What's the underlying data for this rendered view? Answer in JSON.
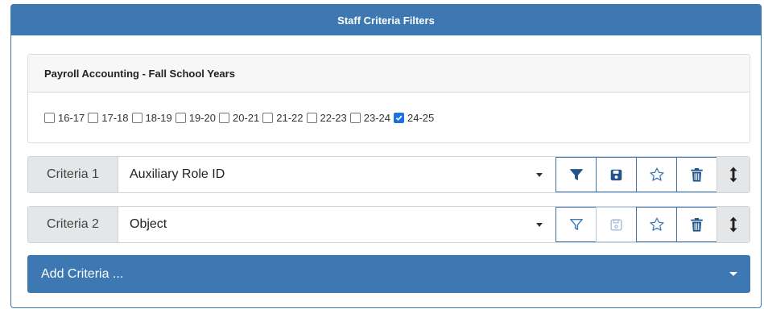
{
  "panel": {
    "title": "Staff Criteria Filters"
  },
  "group": {
    "title": "Payroll Accounting - Fall School Years",
    "years": [
      {
        "label": "16-17",
        "checked": false
      },
      {
        "label": "17-18",
        "checked": false
      },
      {
        "label": "18-19",
        "checked": false
      },
      {
        "label": "19-20",
        "checked": false
      },
      {
        "label": "20-21",
        "checked": false
      },
      {
        "label": "21-22",
        "checked": false
      },
      {
        "label": "22-23",
        "checked": false
      },
      {
        "label": "23-24",
        "checked": false
      },
      {
        "label": "24-25",
        "checked": true
      }
    ]
  },
  "criteria": [
    {
      "label": "Criteria 1",
      "value": "Auxiliary Role ID",
      "filter_active": true,
      "save_enabled": true
    },
    {
      "label": "Criteria 2",
      "value": "Object",
      "filter_active": false,
      "save_enabled": false
    }
  ],
  "add_criteria": {
    "label": "Add Criteria ..."
  },
  "colors": {
    "primary": "#3d78b2",
    "checkbox_checked": "#1e6fe0",
    "label_bg": "#e4e6e8"
  },
  "icons": [
    "filter-icon",
    "save-icon",
    "star-icon",
    "trash-icon",
    "vertical-arrows-icon",
    "chevron-down-icon"
  ]
}
